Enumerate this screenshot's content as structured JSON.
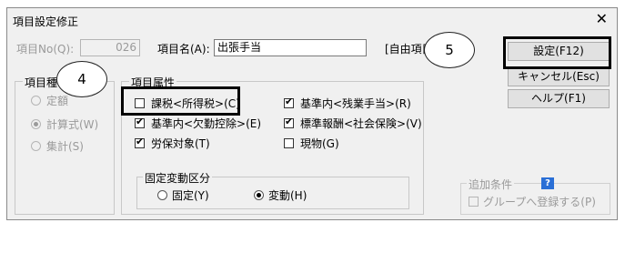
{
  "dialog": {
    "title": "項目設定修正",
    "close_glyph": "✕"
  },
  "header": {
    "item_no_label": "項目No(Q):",
    "item_no_value": "026",
    "item_name_label": "項目名(A):",
    "item_name_value": "出張手当",
    "free_item_label": "[自由項目"
  },
  "buttons": {
    "settings": "設定(F12)",
    "cancel": "キャンセル(Esc)",
    "help": "ヘルプ(F1)"
  },
  "item_type": {
    "legend": "項目種",
    "options": [
      {
        "label": "定額",
        "checked": false
      },
      {
        "label": "計算式(W)",
        "checked": true
      },
      {
        "label": "集計(S)",
        "checked": false
      }
    ]
  },
  "attributes": {
    "legend": "項目属性",
    "checkboxes": [
      {
        "label": "課税<所得税>(C)",
        "checked": false
      },
      {
        "label": "基準内<残業手当>(R)",
        "checked": true
      },
      {
        "label": "基準内<欠勤控除>(E)",
        "checked": true
      },
      {
        "label": "標準報酬<社会保険>(V)",
        "checked": true
      },
      {
        "label": "労保対象(T)",
        "checked": true
      },
      {
        "label": "現物(G)",
        "checked": false
      }
    ],
    "fixed_variable": {
      "legend": "固定変動区分",
      "options": [
        {
          "label": "固定(Y)",
          "checked": false
        },
        {
          "label": "変動(H)",
          "checked": true
        }
      ]
    }
  },
  "additional": {
    "legend": "追加条件",
    "help_badge": "?",
    "checkbox_label": "グループへ登録する(P)",
    "checked": false
  },
  "annotations": {
    "step4": "4",
    "step5": "5"
  }
}
